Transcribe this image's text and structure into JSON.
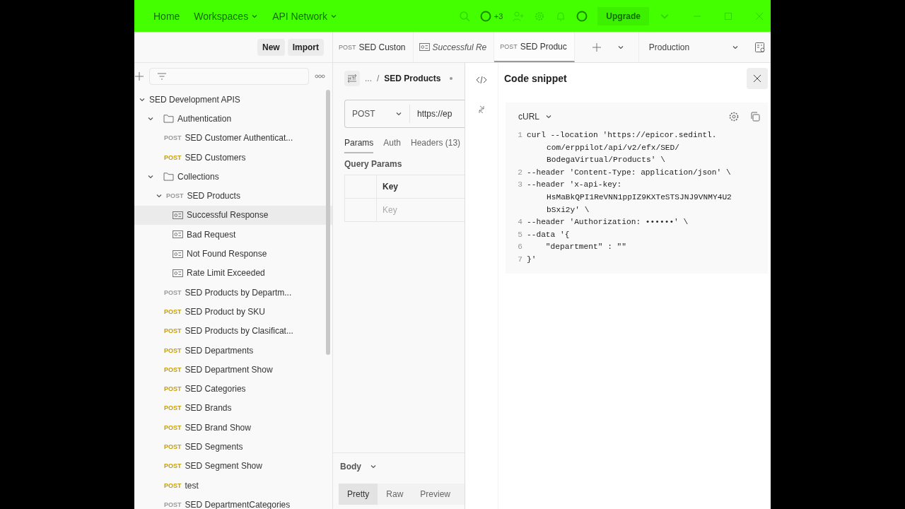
{
  "top_bar": {
    "nav": [
      {
        "label": "Home",
        "has_caret": false
      },
      {
        "label": "Workspaces",
        "has_caret": true
      },
      {
        "label": "API Network",
        "has_caret": true
      }
    ],
    "collaborators": "+3",
    "upgrade": "Upgrade"
  },
  "sidebar": {
    "buttons": [
      "New",
      "Import"
    ],
    "tree": [
      {
        "label": "SED Development APIS",
        "expanded": true,
        "selected": false,
        "children": [
          {
            "kind": "folder",
            "label": "Authentication",
            "expanded": true,
            "selected": false,
            "children": [
              {
                "kind": "request",
                "method": "POST",
                "color": "#9a9a9a",
                "label": "SED Customer Authenticat...",
                "selected": false
              },
              {
                "kind": "request",
                "method": "POST",
                "color": "#c9a100",
                "label": "SED Customers",
                "selected": false
              }
            ]
          },
          {
            "kind": "folder",
            "label": "Collections",
            "expanded": true,
            "selected": false,
            "children": [
              {
                "kind": "request",
                "method": "POST",
                "color": "#9a9a9a",
                "label": "SED Products",
                "expanded": true,
                "selected": false,
                "children": [
                  {
                    "kind": "example",
                    "label": "Successful Response",
                    "selected": true
                  },
                  {
                    "kind": "example",
                    "label": "Bad Request",
                    "selected": false
                  },
                  {
                    "kind": "example",
                    "label": "Not Found Response",
                    "selected": false
                  },
                  {
                    "kind": "example",
                    "label": "Rate Limit Exceeded",
                    "selected": false
                  }
                ]
              },
              {
                "kind": "request",
                "method": "POST",
                "color": "#9a9a9a",
                "label": "SED Products by Departm...",
                "selected": false
              },
              {
                "kind": "request",
                "method": "POST",
                "color": "#c9a100",
                "label": "SED Product by SKU",
                "selected": false
              },
              {
                "kind": "request",
                "method": "POST",
                "color": "#c9a100",
                "label": "SED Products by Clasificat...",
                "selected": false
              },
              {
                "kind": "request",
                "method": "POST",
                "color": "#c9a100",
                "label": "SED Departments",
                "selected": false
              },
              {
                "kind": "request",
                "method": "POST",
                "color": "#c9a100",
                "label": "SED Department Show",
                "selected": false
              },
              {
                "kind": "request",
                "method": "POST",
                "color": "#c9a100",
                "label": "SED Categories",
                "selected": false
              },
              {
                "kind": "request",
                "method": "POST",
                "color": "#c9a100",
                "label": "SED Brands",
                "selected": false
              },
              {
                "kind": "request",
                "method": "POST",
                "color": "#c9a100",
                "label": "SED Brand Show",
                "selected": false
              },
              {
                "kind": "request",
                "method": "POST",
                "color": "#c9a100",
                "label": "SED Segments",
                "selected": false
              },
              {
                "kind": "request",
                "method": "POST",
                "color": "#c9a100",
                "label": "SED Segment Show",
                "selected": false
              },
              {
                "kind": "request",
                "method": "POST",
                "color": "#c9a100",
                "label": "test",
                "selected": false
              },
              {
                "kind": "request",
                "method": "POST",
                "color": "#9a9a9a",
                "label": "SED DepartmentCategories",
                "selected": false
              }
            ]
          }
        ]
      }
    ]
  },
  "tabs": [
    {
      "kind": "request",
      "method": "POST",
      "label": "SED Custon",
      "selected": false
    },
    {
      "kind": "example",
      "label": "Successful Re",
      "selected": false
    },
    {
      "kind": "request",
      "method": "POST",
      "label": "SED Produc",
      "selected": true
    }
  ],
  "environment": "Production",
  "request": {
    "breadcrumb": [
      "...",
      "/",
      "SED Products"
    ],
    "method": "POST",
    "url": "https://ep",
    "tabs": [
      {
        "label": "Params",
        "selected": true
      },
      {
        "label": "Auth",
        "selected": false
      },
      {
        "label": "Headers (13)",
        "selected": false
      }
    ],
    "section": "Query Params",
    "column": "Key",
    "key_placeholder": "Key",
    "body_label": "Body",
    "views": [
      {
        "label": "Pretty",
        "selected": true
      },
      {
        "label": "Raw",
        "selected": false
      },
      {
        "label": "Preview",
        "selected": false
      }
    ]
  },
  "code_snippet": {
    "title": "Code snippet",
    "language": "cURL",
    "lines": [
      {
        "number": "1",
        "parts": [
          "curl --location 'https://epicor.sedintl.",
          "com/erppilot/api/v2/efx/SED/",
          "BodegaVirtual/Products' \\"
        ]
      },
      {
        "number": "2",
        "parts": [
          "--header 'Content-Type: application/json' \\"
        ]
      },
      {
        "number": "3",
        "parts": [
          "--header 'x-api-key:",
          "HsMaBkQPI1ReVNN1ppIZ9KXTeSTSJNJ9VNMY4U2",
          "bSxi2y' \\"
        ]
      },
      {
        "number": "4",
        "parts": [
          "--header 'Authorization: ••••••' \\"
        ]
      },
      {
        "number": "5",
        "parts": [
          "--data '{"
        ]
      },
      {
        "number": "6",
        "parts": [
          "    \"department\" : \"\""
        ]
      },
      {
        "number": "7",
        "parts": [
          "}'"
        ]
      }
    ]
  }
}
